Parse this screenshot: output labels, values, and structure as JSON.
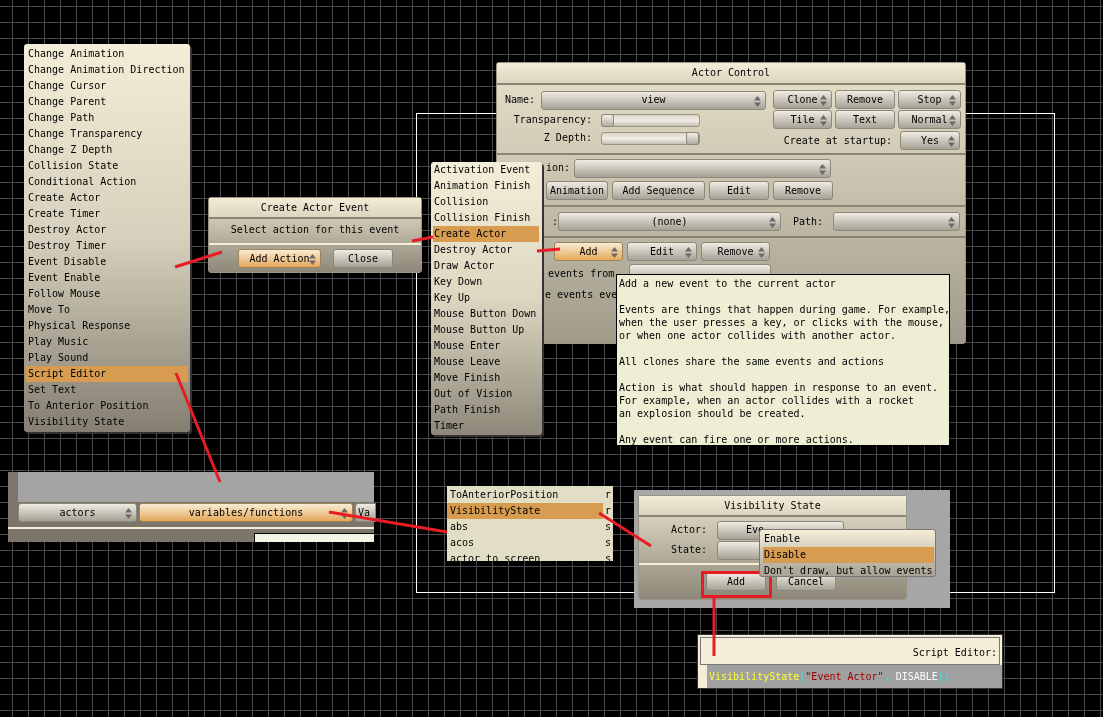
{
  "actions_menu": {
    "items": [
      {
        "label": "Change Animation",
        "selected": false
      },
      {
        "label": "Change Animation Direction",
        "selected": false
      },
      {
        "label": "Change Cursor",
        "selected": false
      },
      {
        "label": "Change Parent",
        "selected": false
      },
      {
        "label": "Change Path",
        "selected": false
      },
      {
        "label": "Change Transparency",
        "selected": false
      },
      {
        "label": "Change Z Depth",
        "selected": false
      },
      {
        "label": "Collision State",
        "selected": false
      },
      {
        "label": "Conditional Action",
        "selected": false
      },
      {
        "label": "Create Actor",
        "selected": false
      },
      {
        "label": "Create Timer",
        "selected": false
      },
      {
        "label": "Destroy Actor",
        "selected": false
      },
      {
        "label": "Destroy Timer",
        "selected": false
      },
      {
        "label": "Event Disable",
        "selected": false
      },
      {
        "label": "Event Enable",
        "selected": false
      },
      {
        "label": "Follow Mouse",
        "selected": false
      },
      {
        "label": "Move To",
        "selected": false
      },
      {
        "label": "Physical Response",
        "selected": false
      },
      {
        "label": "Play Music",
        "selected": false
      },
      {
        "label": "Play Sound",
        "selected": false
      },
      {
        "label": "Script Editor",
        "selected": true
      },
      {
        "label": "Set Text",
        "selected": false
      },
      {
        "label": "To Anterior Position",
        "selected": false
      },
      {
        "label": "Visibility State",
        "selected": false
      }
    ]
  },
  "create_actor_event_dialog": {
    "title": "Create Actor Event",
    "message": "Select action for this event",
    "buttons": [
      {
        "label": "Add Action",
        "dropdown": true,
        "highlighted": true
      },
      {
        "label": "Close",
        "dropdown": false,
        "highlighted": false
      }
    ]
  },
  "events_menu": {
    "items": [
      {
        "label": "Activation Event",
        "selected": false
      },
      {
        "label": "Animation Finish",
        "selected": false
      },
      {
        "label": "Collision",
        "selected": false
      },
      {
        "label": "Collision Finish",
        "selected": false
      },
      {
        "label": "Create Actor",
        "selected": true
      },
      {
        "label": "Destroy Actor",
        "selected": false
      },
      {
        "label": "Draw Actor",
        "selected": false
      },
      {
        "label": "Key Down",
        "selected": false
      },
      {
        "label": "Key Up",
        "selected": false
      },
      {
        "label": "Mouse Button Down",
        "selected": false
      },
      {
        "label": "Mouse Button Up",
        "selected": false
      },
      {
        "label": "Mouse Enter",
        "selected": false
      },
      {
        "label": "Mouse Leave",
        "selected": false
      },
      {
        "label": "Move Finish",
        "selected": false
      },
      {
        "label": "Out of Vision",
        "selected": false
      },
      {
        "label": "Path Finish",
        "selected": false
      },
      {
        "label": "Timer",
        "selected": false
      }
    ]
  },
  "actor_control": {
    "title": "Actor Control",
    "name_label": "Name:",
    "name_value": "view",
    "buttons": [
      {
        "label": "Clone",
        "dropdown": true,
        "highlighted": false
      },
      {
        "label": "Remove",
        "dropdown": false,
        "highlighted": false
      },
      {
        "label": "Stop",
        "dropdown": true,
        "highlighted": false
      },
      {
        "label": "Tile",
        "dropdown": true,
        "highlighted": false
      },
      {
        "label": "Text",
        "dropdown": false,
        "highlighted": false
      },
      {
        "label": "Normal",
        "dropdown": true,
        "highlighted": false
      }
    ],
    "transparency": {
      "label": "Transparency:",
      "level": 0
    },
    "z_depth": {
      "label": "Z Depth:",
      "level": 1
    },
    "create_at_startup": {
      "label": "Create at startup:",
      "value": "Yes"
    },
    "animation_label": "ion:",
    "animation_buttons": [
      {
        "label": "Animation",
        "dropdown": false,
        "highlighted": false
      },
      {
        "label": "Add Sequence",
        "dropdown": false,
        "highlighted": false
      },
      {
        "label": "Edit",
        "dropdown": false,
        "highlighted": false
      },
      {
        "label": "Remove",
        "dropdown": false,
        "highlighted": false
      }
    ],
    "parent_label": ":",
    "parent_value": "(none)",
    "path_label": "Path:",
    "event_buttons": [
      {
        "label": "Add",
        "dropdown": true,
        "highlighted": true
      },
      {
        "label": "Edit",
        "dropdown": true,
        "highlighted": false
      },
      {
        "label": "Remove",
        "dropdown": true,
        "highlighted": false
      }
    ],
    "inherit_label": "events from",
    "edit_events_label": "e events eve"
  },
  "tooltip": {
    "paragraphs": [
      "Add a new event to the current actor",
      "Events are things that happen during game. For example,\nwhen the user presses a key, or clicks with the mouse,\nor when one actor collides with another actor.",
      "All clones share the same events and actions",
      "Action is what should happen in response to an event.\nFor example, when an actor collides with a rocket\nan explosion should be created.",
      "Any event can fire one or more actions."
    ]
  },
  "script_panel": {
    "buttons": [
      {
        "label": "actors",
        "dropdown": true,
        "highlighted": false
      },
      {
        "label": "variables/functions",
        "dropdown": true,
        "highlighted": true
      },
      {
        "label": "Va",
        "dropdown": false,
        "highlighted": false
      }
    ]
  },
  "function_list": {
    "items": [
      {
        "label": "ToAnteriorPosition",
        "column_2": "r",
        "selected": false
      },
      {
        "label": "VisibilityState",
        "column_2": "r",
        "selected": true
      },
      {
        "label": "abs",
        "column_2": "s",
        "selected": false
      },
      {
        "label": "acos",
        "column_2": "s",
        "selected": false
      },
      {
        "label": "actor to screen",
        "column_2": "s",
        "selected": false
      }
    ]
  },
  "visibility_dialog": {
    "title": "Visibility State",
    "actor_label": "Actor:",
    "actor_value": "Eve",
    "state_label": "State:",
    "buttons": [
      {
        "label": "Add",
        "dropdown": false,
        "highlighted": false
      },
      {
        "label": "Cancel",
        "dropdown": false,
        "highlighted": false
      }
    ]
  },
  "state_menu": {
    "items": [
      {
        "label": "Enable",
        "selected": false
      },
      {
        "label": "Disable",
        "selected": true
      },
      {
        "label": "Don't draw, but allow events",
        "selected": false
      }
    ]
  },
  "script_editor": {
    "title": "Script Editor:",
    "code": [
      {
        "kind": "function",
        "text": "VisibilityState"
      },
      {
        "kind": "punct",
        "text": "("
      },
      {
        "kind": "string",
        "text": "\"Event Actor\""
      },
      {
        "kind": "punct",
        "text": ", "
      },
      {
        "kind": "constant",
        "text": "DISABLE"
      },
      {
        "kind": "punct",
        "text": ");"
      }
    ]
  }
}
